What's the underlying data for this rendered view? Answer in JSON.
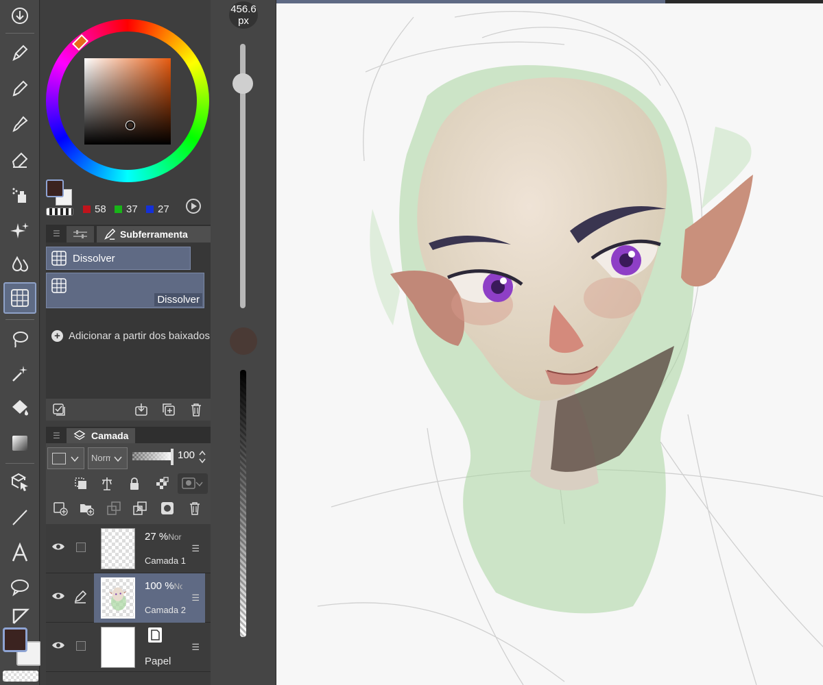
{
  "brush": {
    "size_value": "456.6",
    "size_unit": "px"
  },
  "color": {
    "main": "#3b2320",
    "sub": "#f2f2f2",
    "rgb": {
      "r": "58",
      "g": "37",
      "b": "27"
    },
    "rgb_swatch_colors": {
      "r": "#c0141c",
      "g": "#18b418",
      "b": "#1430d8"
    }
  },
  "subtool_panel": {
    "tab_label": "Subferramenta",
    "items": [
      {
        "label": "Dissolver"
      },
      {
        "label": "Dissolver"
      }
    ],
    "add_label": "Adicionar a partir dos baixados"
  },
  "layer_panel": {
    "tab_label": "Camada",
    "blend_mode": "Norm",
    "opacity": "100",
    "layers": [
      {
        "opacity": "27 %",
        "mode": "Nor",
        "name": "Camada 1",
        "selected": false
      },
      {
        "opacity": "100 %",
        "mode": "No",
        "name": "Camada 2",
        "selected": true
      },
      {
        "opacity": "",
        "mode": "",
        "name": "Papel",
        "selected": false
      }
    ]
  },
  "canvas": {
    "progress": 0.71
  },
  "icons": {
    "toolbar": [
      "download-icon",
      "pen-icon",
      "pencil-icon",
      "brush-icon",
      "eraser-icon",
      "airbrush-icon",
      "sparkle-icon",
      "blend-icon",
      "dissolve-icon",
      "lasso-icon",
      "magic-wand-icon",
      "fill-icon",
      "gradient-icon",
      "move-icon",
      "line-icon",
      "text-icon",
      "balloon-icon",
      "ruler-icon"
    ]
  }
}
